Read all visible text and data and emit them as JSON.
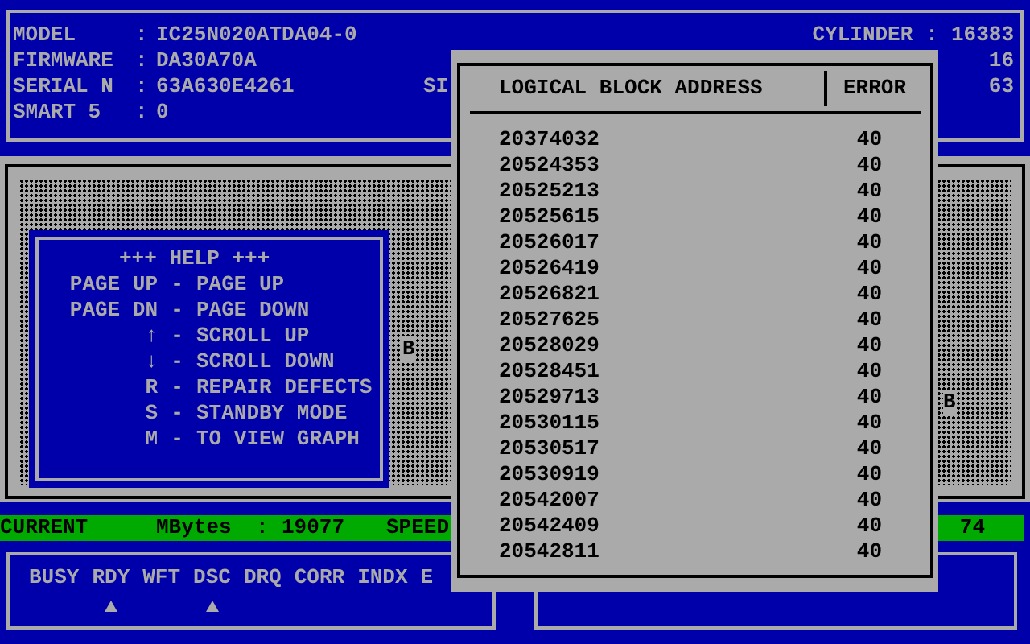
{
  "drive_info": {
    "left": [
      {
        "label": "MODEL",
        "separator": ":",
        "value": "IC25N020ATDA04-0"
      },
      {
        "label": "FIRMWARE",
        "separator": ":",
        "value": "DA30A70A"
      },
      {
        "label": "SERIAL N",
        "separator": ":",
        "value": "63A630E4261",
        "fragment": "SI"
      },
      {
        "label": "SMART 5",
        "separator": ":",
        "value": "0"
      }
    ],
    "right": [
      {
        "label": "CYLINDER",
        "separator": ":",
        "value": "16383"
      },
      {
        "value": "16"
      },
      {
        "value": "63"
      }
    ]
  },
  "help": {
    "title": "+++ HELP +++",
    "items": [
      {
        "key": "PAGE UP",
        "separator": "-",
        "action": "PAGE UP"
      },
      {
        "key": "PAGE DN",
        "separator": "-",
        "action": "PAGE DOWN"
      },
      {
        "key": "↑",
        "separator": "-",
        "action": "SCROLL UP"
      },
      {
        "key": "↓",
        "separator": "-",
        "action": "SCROLL DOWN"
      },
      {
        "key": "R",
        "separator": "-",
        "action": "REPAIR DEFECTS"
      },
      {
        "key": "S",
        "separator": "-",
        "action": "STANDBY MODE"
      },
      {
        "key": "M",
        "separator": "-",
        "action": "TO VIEW GRAPH"
      }
    ]
  },
  "markers": [
    "B",
    "B"
  ],
  "status_bar": {
    "current": "CURRENT",
    "mbytes_label": "MBytes",
    "separator": ":",
    "mbytes_value": "19077",
    "speed_label": "SPEED",
    "speed_value": "74"
  },
  "flags": [
    {
      "label": "BUSY",
      "on": false
    },
    {
      "label": "RDY",
      "on": true
    },
    {
      "label": "WFT",
      "on": false
    },
    {
      "label": "DSC",
      "on": true
    },
    {
      "label": "DRQ",
      "on": false
    },
    {
      "label": "CORR",
      "on": false
    },
    {
      "label": "INDX",
      "on": false
    },
    {
      "label": "E",
      "on": false
    }
  ],
  "error_list": {
    "columns": [
      "LOGICAL BLOCK ADDRESS",
      "ERROR"
    ],
    "rows": [
      {
        "address": "20374032",
        "error": "40"
      },
      {
        "address": "20524353",
        "error": "40"
      },
      {
        "address": "20525213",
        "error": "40"
      },
      {
        "address": "20525615",
        "error": "40"
      },
      {
        "address": "20526017",
        "error": "40"
      },
      {
        "address": "20526419",
        "error": "40"
      },
      {
        "address": "20526821",
        "error": "40"
      },
      {
        "address": "20527625",
        "error": "40"
      },
      {
        "address": "20528029",
        "error": "40"
      },
      {
        "address": "20528451",
        "error": "40"
      },
      {
        "address": "20529713",
        "error": "40"
      },
      {
        "address": "20530115",
        "error": "40"
      },
      {
        "address": "20530517",
        "error": "40"
      },
      {
        "address": "20530919",
        "error": "40"
      },
      {
        "address": "20542007",
        "error": "40"
      },
      {
        "address": "20542409",
        "error": "40"
      },
      {
        "address": "20542811",
        "error": "40"
      }
    ]
  }
}
